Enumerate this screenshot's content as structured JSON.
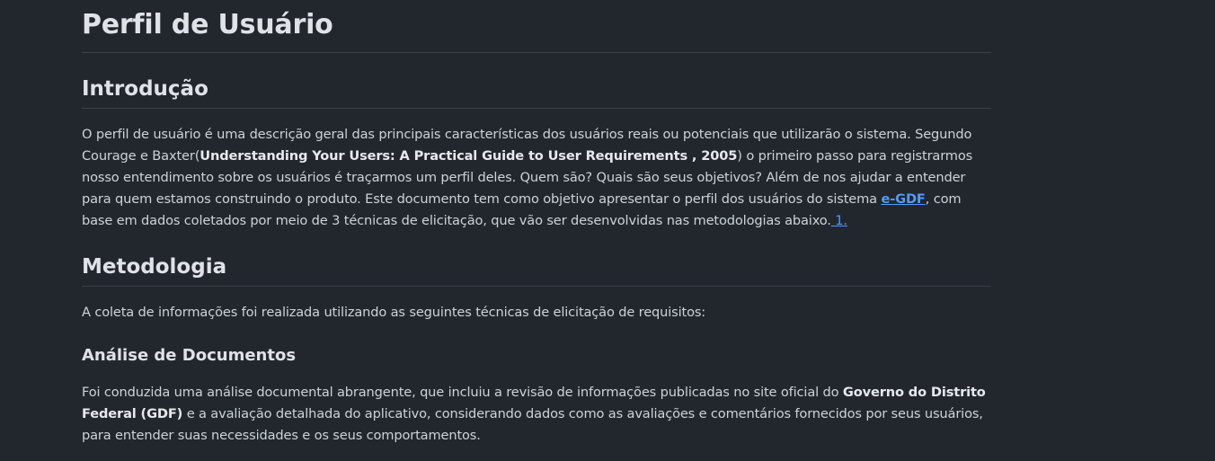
{
  "page": {
    "title": "Perfil de Usuário"
  },
  "intro": {
    "heading": "Introdução",
    "text_1": "O perfil de usuário é uma descrição geral das principais características dos usuários reais ou potenciais que utilizarão o sistema. Segundo Courage e Baxter(",
    "book_ref": "Understanding Your Users: A Practical Guide to User Requirements , 2005",
    "text_2": ") o primeiro passo para registrarmos nosso entendimento sobre os usuários é traçarmos um perfil deles. Quem são? Quais são seus objetivos? Além de nos ajudar a entender para quem estamos construindo o produto. Este documento tem como objetivo apresentar o perfil dos usuários do sistema ",
    "system_link": "e-GDF",
    "text_3": ", com base em dados coletados por meio de 3 técnicas de elicitação, que vão ser desenvolvidas nas metodologias abaixo.",
    "footnote_link": " 1."
  },
  "methodology": {
    "heading": "Metodologia",
    "text": "A coleta de informações foi realizada utilizando as seguintes técnicas de elicitação de requisitos:"
  },
  "document_analysis": {
    "heading": "Análise de Documentos",
    "text_1": "Foi conduzida uma análise documental abrangente, que incluiu a revisão de informações publicadas no site oficial do ",
    "gov_name": "Governo do Distrito Federal (GDF)",
    "text_2": " e a avaliação detalhada do aplicativo, considerando dados como as avaliações e comentários fornecidos por seus usuários, para entender suas necessidades e os seus comportamentos."
  }
}
